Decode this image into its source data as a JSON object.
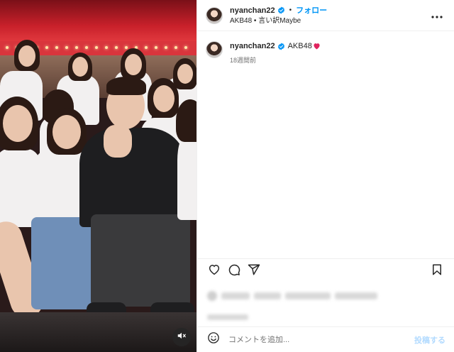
{
  "header": {
    "username": "nyanchan22",
    "separator": "•",
    "follow_label": "フォロー",
    "subtitle": "AKB48 • 言い訳Maybe",
    "more_icon": "more-horizontal-icon"
  },
  "caption": {
    "username": "nyanchan22",
    "text": "AKB48",
    "emoji": "red-heart",
    "time": "18週間前"
  },
  "actions": {
    "like_icon": "heart-outline-icon",
    "comment_icon": "comment-bubble-icon",
    "share_icon": "paper-plane-icon",
    "save_icon": "bookmark-icon"
  },
  "comment_box": {
    "placeholder": "コメントを追加...",
    "post_label": "投稿する",
    "emoji_icon": "smiley-icon"
  },
  "media": {
    "mute_icon": "speaker-muted-icon"
  },
  "colors": {
    "accent": "#0095f6",
    "verified": "#0095f6",
    "heart": "#e0245e",
    "post_disabled": "#b3dbff"
  }
}
